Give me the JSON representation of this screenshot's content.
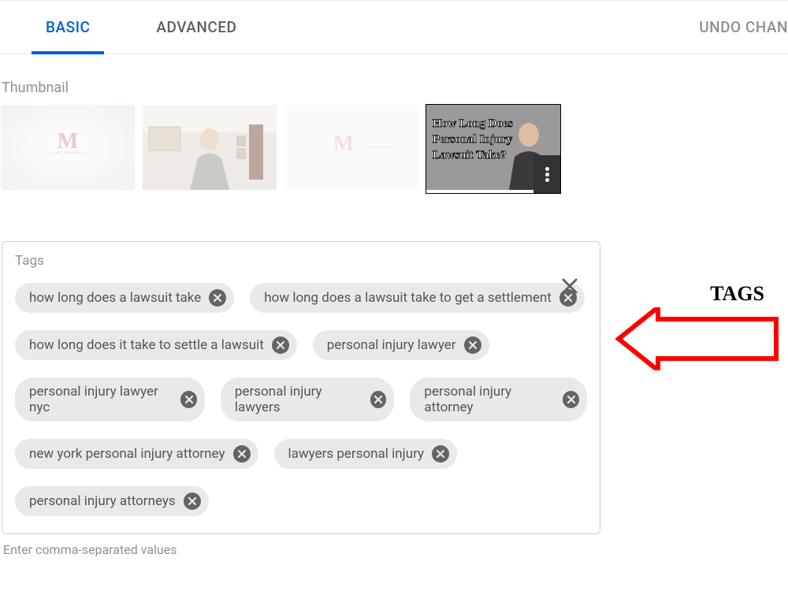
{
  "header": {
    "tabs": {
      "basic": "BASIC",
      "advanced": "ADVANCED"
    },
    "undo": "UNDO CHAN"
  },
  "thumbnail": {
    "label": "Thumbnail",
    "selectedCaptionLine1": "How Long Does",
    "selectedCaptionLine2": "Personal Injury",
    "selectedCaptionLine3": "Lawsuit Take?"
  },
  "tags": {
    "label": "Tags",
    "helper": "Enter comma-separated values",
    "rows": [
      [
        "how long does a lawsuit take",
        "how long does a lawsuit take to get a settlement"
      ],
      [
        "how long does it take to settle a lawsuit",
        "personal injury lawyer"
      ],
      [
        "personal injury lawyer nyc",
        "personal injury lawyers",
        "personal injury attorney"
      ],
      [
        "new york personal injury attorney",
        "lawyers personal injury"
      ],
      [
        "personal injury attorneys"
      ]
    ]
  },
  "annotation": {
    "label": "TAGS"
  }
}
